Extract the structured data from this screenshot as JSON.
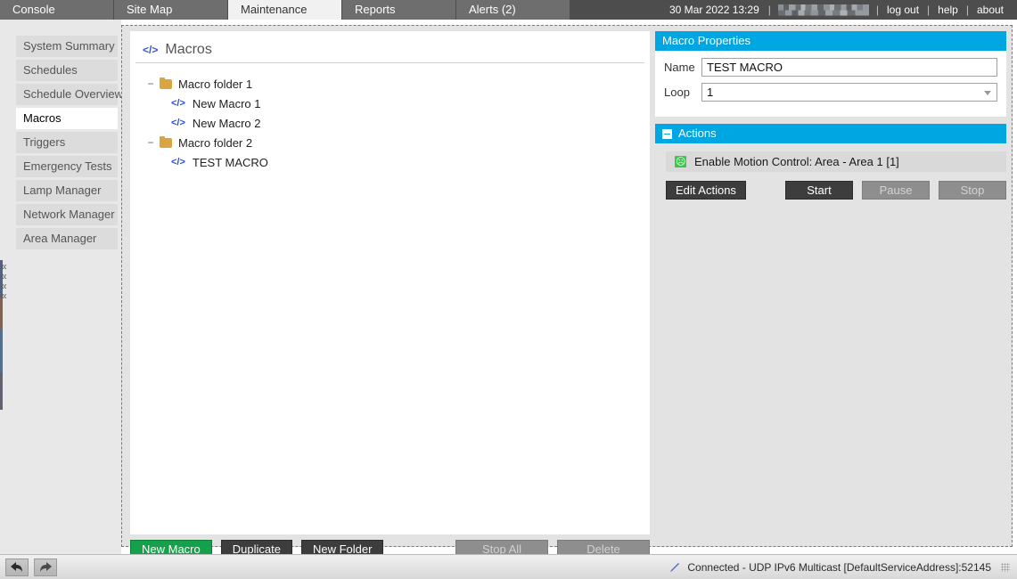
{
  "topbar": {
    "tabs": [
      {
        "label": "Console",
        "active": false
      },
      {
        "label": "Site Map",
        "active": false
      },
      {
        "label": "Maintenance",
        "active": true
      },
      {
        "label": "Reports",
        "active": false
      },
      {
        "label": "Alerts (2)",
        "active": false
      }
    ],
    "datetime": "30 Mar 2022 13:29",
    "user_redacted": "",
    "links": [
      "log out",
      "help",
      "about"
    ],
    "separator": "|"
  },
  "sidebar": {
    "items": [
      {
        "label": "System Summary",
        "active": false
      },
      {
        "label": "Schedules",
        "active": false
      },
      {
        "label": "Schedule Overview",
        "active": false
      },
      {
        "label": "Macros",
        "active": true
      },
      {
        "label": "Triggers",
        "active": false
      },
      {
        "label": "Emergency Tests",
        "active": false
      },
      {
        "label": "Lamp Manager",
        "active": false
      },
      {
        "label": "Network Manager",
        "active": false
      },
      {
        "label": "Area Manager",
        "active": false
      }
    ],
    "collapse_glyph": "«",
    "collapse_count": 4
  },
  "tree": {
    "title": "Macros",
    "title_icon": "</>",
    "nodes": [
      {
        "label": "Macro folder 1",
        "type": "folder",
        "expander": "−",
        "icon": "folder-icon"
      },
      {
        "label": "New Macro 1",
        "type": "macro",
        "icon": "code-icon"
      },
      {
        "label": "New Macro 2",
        "type": "macro",
        "icon": "code-icon"
      },
      {
        "label": "Macro folder 2",
        "type": "folder",
        "expander": "−",
        "icon": "folder-icon"
      },
      {
        "label": "TEST MACRO",
        "type": "macro",
        "icon": "code-icon"
      }
    ],
    "buttons": [
      {
        "label": "New Macro",
        "style": "green",
        "disabled": false
      },
      {
        "label": "Duplicate",
        "style": "dark",
        "disabled": false
      },
      {
        "label": "New Folder",
        "style": "dark",
        "disabled": false
      },
      {
        "label": "Stop All",
        "style": "dark",
        "disabled": true
      },
      {
        "label": "Delete",
        "style": "dark",
        "disabled": true
      }
    ]
  },
  "properties": {
    "header": "Macro Properties",
    "name_label": "Name",
    "name_value": "TEST MACRO",
    "name_placeholder": "",
    "loop_label": "Loop",
    "loop_value": "1",
    "loop_options": [
      "1"
    ]
  },
  "actions": {
    "header": "Actions",
    "items": [
      {
        "label": "Enable Motion Control: Area - Area 1 [1]",
        "icon": "motion-control-icon"
      }
    ],
    "buttons": [
      {
        "label": "Edit Actions",
        "disabled": false
      },
      {
        "label": "Start",
        "disabled": false
      },
      {
        "label": "Pause",
        "disabled": true
      },
      {
        "label": "Stop",
        "disabled": true
      }
    ]
  },
  "statusbar": {
    "back_label": "Back",
    "forward_label": "Forward",
    "connection": "Connected - UDP IPv6 Multicast [DefaultServiceAddress]:52145"
  },
  "colors": {
    "accent": "#00a6e2",
    "green": "#15a04a",
    "dark_button": "#3d3d3d",
    "folder": "#d9a441",
    "macro_glyph": "#2a4fd6",
    "motion_icon": "#3cc64a",
    "tab_inactive": "#6e6e6e",
    "tab_active": "#f1f1f1",
    "topbar_bg": "#4d4d4d"
  }
}
